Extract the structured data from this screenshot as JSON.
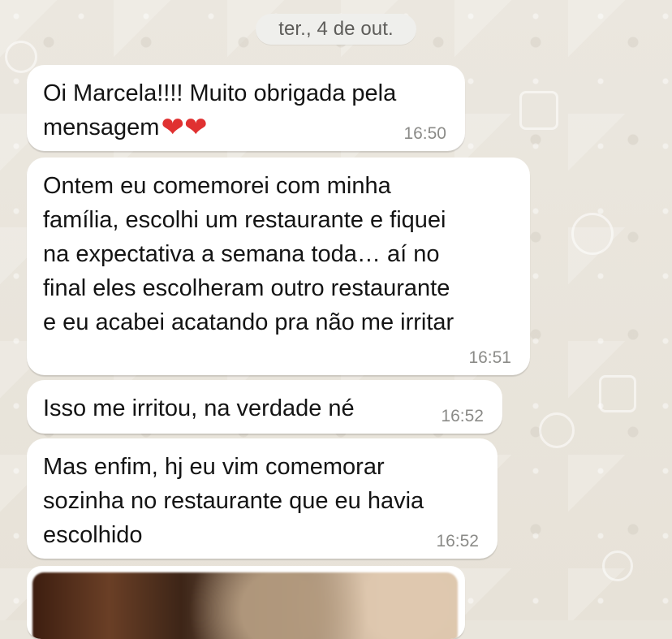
{
  "date_chip": "ter., 4 de out.",
  "messages": [
    {
      "text": "Oi Marcela!!!! Muito obrigada pela\nmensagem",
      "emoji": "❤❤",
      "time": "16:50"
    },
    {
      "text": "Ontem eu comemorei com minha\nfamília, escolhi um restaurante e fiquei\nna expectativa a semana toda… aí no\nfinal eles escolheram outro restaurante\ne eu acabei acatando pra não me irritar",
      "time": "16:51"
    },
    {
      "text": "Isso me irritou, na verdade né",
      "time": "16:52"
    },
    {
      "text": "Mas enfim, hj eu vim comemorar\nsozinha no restaurante que eu havia\nescolhido",
      "time": "16:52"
    }
  ],
  "colors": {
    "background": "#e9e5dc",
    "bubble": "#ffffff",
    "chip": "#efefec",
    "text": "#141414",
    "time": "#8b8b88",
    "heart": "#e03131"
  }
}
